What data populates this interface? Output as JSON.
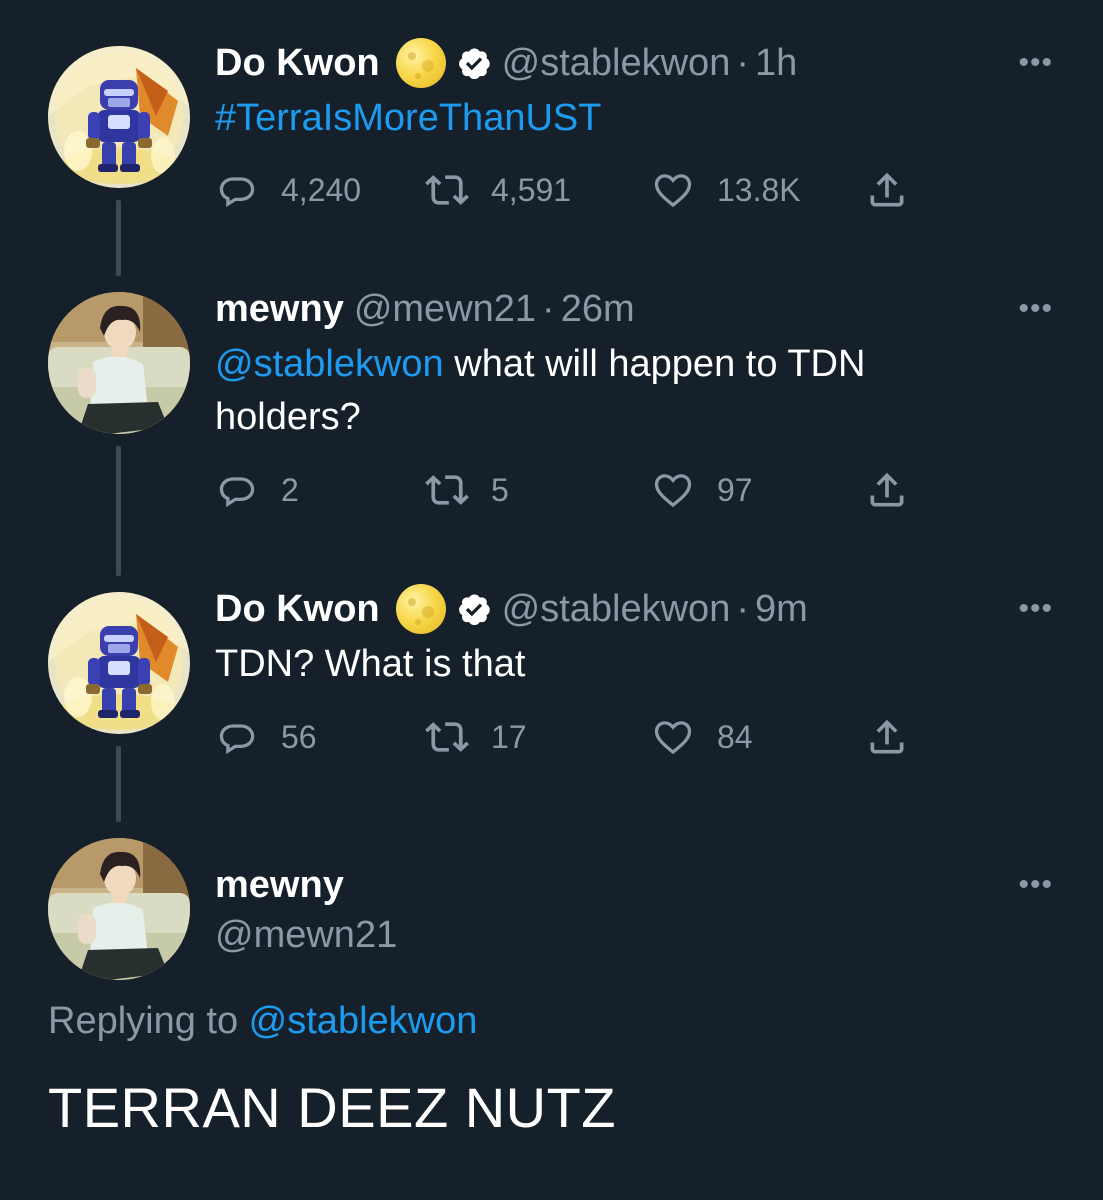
{
  "tweets": [
    {
      "name": "Do Kwon",
      "handle": "@stablekwon",
      "separator": "·",
      "time": "1h",
      "hashtag": "#TerraIsMoreThanUST",
      "replies": "4,240",
      "retweets": "4,591",
      "likes": "13.8K",
      "avatar": "robot-avatar",
      "badges": [
        "moon-emoji",
        "verified-icon"
      ]
    },
    {
      "name": "mewny",
      "handle": "@mewn21",
      "separator": "·",
      "time": "26m",
      "mention": "@stablekwon",
      "text_line1": " what will happen to TDN",
      "text_line2": "holders?",
      "replies": "2",
      "retweets": "5",
      "likes": "97",
      "avatar": "anime-boy-avatar"
    },
    {
      "name": "Do Kwon",
      "handle": "@stablekwon",
      "separator": "·",
      "time": "9m",
      "text": "TDN? What is that",
      "replies": "56",
      "retweets": "17",
      "likes": "84",
      "avatar": "robot-avatar",
      "badges": [
        "moon-emoji",
        "verified-icon"
      ]
    },
    {
      "name": "mewny",
      "handle": "@mewn21",
      "replying_label": "Replying to ",
      "replying_handle": "@stablekwon",
      "text": "TERRAN DEEZ NUTZ",
      "avatar": "anime-boy-avatar"
    }
  ],
  "more_label": "•••",
  "colors": {
    "background": "#15202b",
    "link": "#1d9bf0",
    "secondary": "#8b98a5",
    "thread_line": "#3d4a57"
  }
}
